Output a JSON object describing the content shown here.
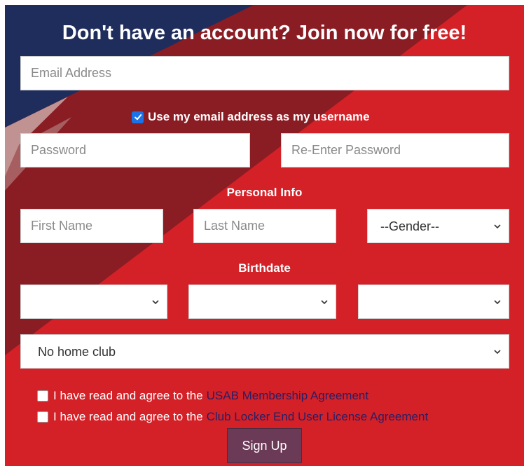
{
  "heading": "Don't have an account? Join now for free!",
  "email": {
    "placeholder": "Email Address",
    "value": ""
  },
  "username_option": {
    "label": "Use my email address as my username",
    "checked": true
  },
  "password": {
    "placeholder": "Password"
  },
  "reenter_password": {
    "placeholder": "Re-Enter Password"
  },
  "personal_info": {
    "label": "Personal Info",
    "first_name_placeholder": "First Name",
    "last_name_placeholder": "Last Name",
    "gender_selected": "--Gender--"
  },
  "birthdate": {
    "label": "Birthdate",
    "month_selected": "",
    "day_selected": "",
    "year_selected": ""
  },
  "home_club": {
    "selected": "No home club"
  },
  "agreements": [
    {
      "text": "I have read and agree to the",
      "link": "USAB Membership Agreement",
      "checked": false
    },
    {
      "text": "I have read and agree to the",
      "link": "Club Locker End User License Agreement",
      "checked": false
    }
  ],
  "signup_label": "Sign Up",
  "colors": {
    "background_red": "#d42027",
    "dark_red": "#8a1c23",
    "navy": "#1f2d5c",
    "link": "#2b1e63",
    "button": "#6b3a57",
    "checkbox_blue": "#1a73e8"
  }
}
